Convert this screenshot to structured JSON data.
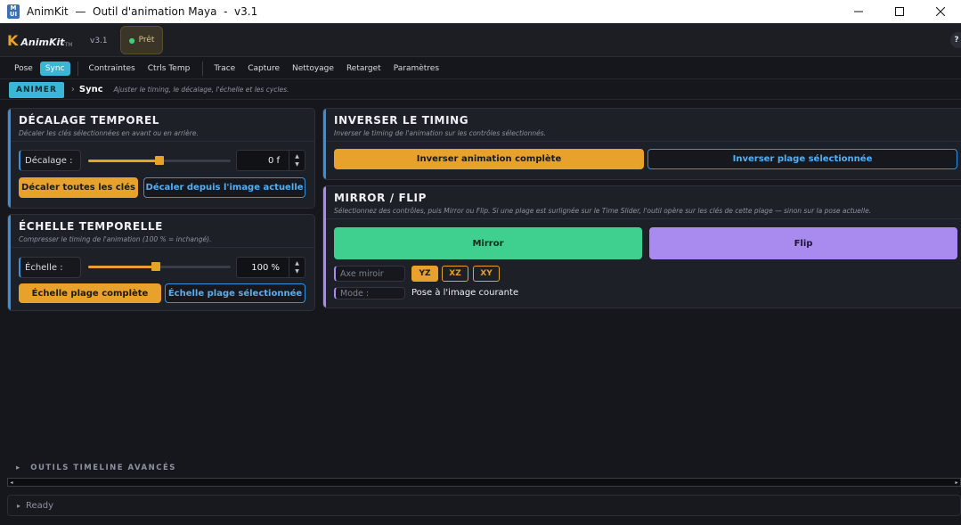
{
  "window": {
    "app_icon": "app-icon",
    "title": "AnimKit  —  Outil d'animation Maya  -  v3.1",
    "icon_text_top": "M",
    "icon_text_bottom": "UI",
    "minimize_icon": "minimize-icon",
    "maximize_icon": "maximize-icon",
    "close_icon": "close-icon"
  },
  "header": {
    "logo_letter": "K",
    "logo_name": "AnimKit",
    "logo_tm": "TM",
    "version": "v3.1",
    "status": "Prêt",
    "help": "?"
  },
  "tabs": [
    {
      "label": "Pose"
    },
    {
      "label": "Sync",
      "active": true
    },
    {
      "label": "Contraintes"
    },
    {
      "label": "Ctrls Temp"
    },
    {
      "label": "Trace"
    },
    {
      "label": "Capture"
    },
    {
      "label": "Nettoyage"
    },
    {
      "label": "Retarget"
    },
    {
      "label": "Paramètres"
    }
  ],
  "breadcrumb": {
    "root": "ANIMER",
    "current": "Sync",
    "description": "Ajuster le timing, le décalage, l'échelle et les cycles."
  },
  "offset_panel": {
    "title": "DÉCALAGE TEMPOREL",
    "subtitle": "Décaler les clés sélectionnées en avant ou en arrière.",
    "field_label": "Décalage :",
    "value": "0 f",
    "slider_position": 0.5,
    "btn_all": "Décaler toutes les clés",
    "btn_current": "Décaler depuis l'image actuelle"
  },
  "scale_panel": {
    "title": "ÉCHELLE TEMPORELLE",
    "subtitle": "Compresser le timing de l'animation (100 % = inchangé).",
    "field_label": "Échelle :",
    "value": "100 %",
    "slider_position": 0.5,
    "btn_full": "Échelle plage complète",
    "btn_selected": "Échelle plage sélectionnée"
  },
  "reverse_panel": {
    "title": "INVERSER LE TIMING",
    "subtitle": "Inverser le timing de l'animation sur les contrôles sélectionnés.",
    "btn_full": "Inverser animation complète",
    "btn_selected": "Inverser plage sélectionnée"
  },
  "mirror_panel": {
    "title": "MIRROR / FLIP",
    "subtitle": "Sélectionnez des contrôles, puis Mirror ou Flip. Si une plage est surlignée sur le Time Slider, l'outil opère sur les clés de cette plage — sinon sur la pose actuelle.",
    "btn_mirror": "Mirror",
    "btn_flip": "Flip",
    "axis_label": "Axe miroir",
    "axes": [
      {
        "label": "YZ",
        "active": true
      },
      {
        "label": "XZ",
        "active": false
      },
      {
        "label": "XY",
        "active": false
      }
    ],
    "mode_label": "Mode :",
    "mode_value": "Pose à l'image courante"
  },
  "advanced": {
    "label": "OUTILS TIMELINE AVANCÉS",
    "arrow": "▸"
  },
  "scrollbar": {
    "left_arrow": "◂",
    "right_arrow": "▸"
  },
  "status_bar": {
    "arrow": "▸",
    "text": "Ready"
  },
  "colors": {
    "accent_cyan": "#3ab6d6",
    "accent_orange": "#e8a12b",
    "accent_blue": "#3a8fd6",
    "mirror_green": "#3fcf8e",
    "flip_purple": "#a98bf0"
  }
}
